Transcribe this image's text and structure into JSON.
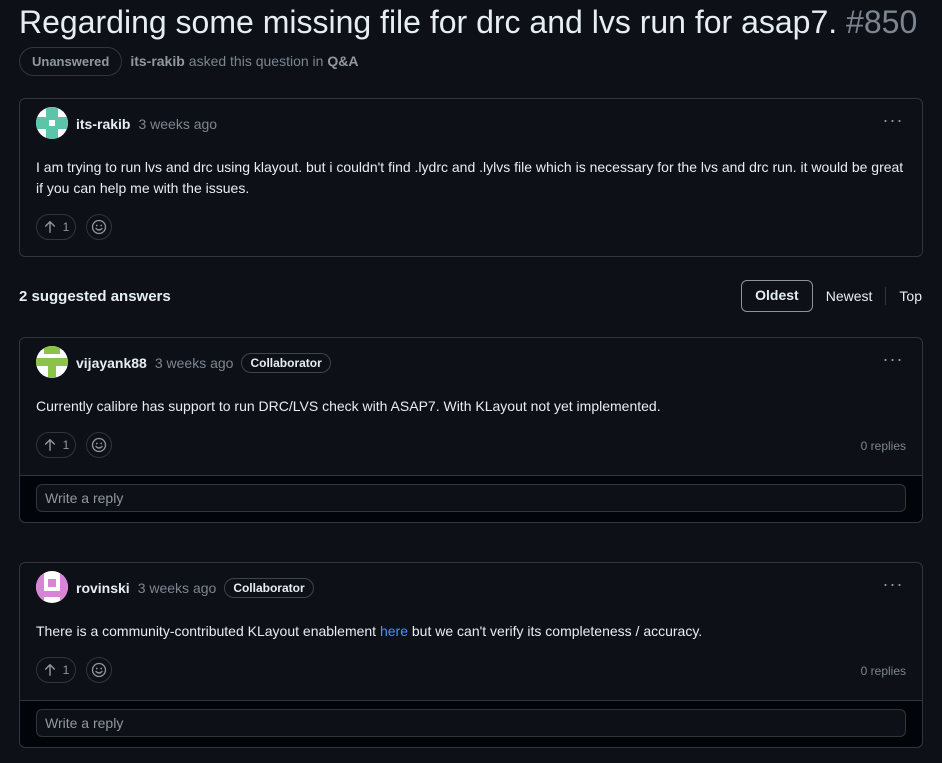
{
  "discussion": {
    "title": "Regarding some missing file for drc and lvs run for asap7.",
    "number": "#850",
    "status": "Unanswered",
    "author": "its-rakib",
    "asked_text": "asked this question in",
    "category": "Q&A"
  },
  "question": {
    "author": "its-rakib",
    "time": "3 weeks ago",
    "body": "I am trying to run lvs and drc using klayout. but i couldn't find .lydrc and .lylvs file which is necessary for the lvs and drc run. it would be great if you can help me with the issues.",
    "votes": "1",
    "menu": "···"
  },
  "answers_header": "2 suggested answers",
  "sort": {
    "options": [
      "Oldest",
      "Newest",
      "Top"
    ],
    "selected": "Oldest"
  },
  "answers": [
    {
      "author": "vijayank88",
      "time": "3 weeks ago",
      "badge": "Collaborator",
      "body": "Currently calibre has support to run DRC/LVS check with ASAP7. With KLayout not yet implemented.",
      "votes": "1",
      "replies": "0 replies",
      "reply_placeholder": "Write a reply",
      "menu": "···"
    },
    {
      "author": "rovinski",
      "time": "3 weeks ago",
      "badge": "Collaborator",
      "body_before": "There is a community-contributed KLayout enablement ",
      "body_link": "here",
      "body_after": " but we can't verify its completeness / accuracy.",
      "votes": "1",
      "replies": "0 replies",
      "reply_placeholder": "Write a reply",
      "menu": "···"
    }
  ],
  "colors": {
    "background": "#0d1117",
    "border": "#30363d",
    "muted": "#7d8590",
    "link": "#4493f8",
    "avatar_rakib": "#5cc4a8",
    "avatar_vijay": "#8bc34a",
    "avatar_rovinski": "#d985d6"
  }
}
